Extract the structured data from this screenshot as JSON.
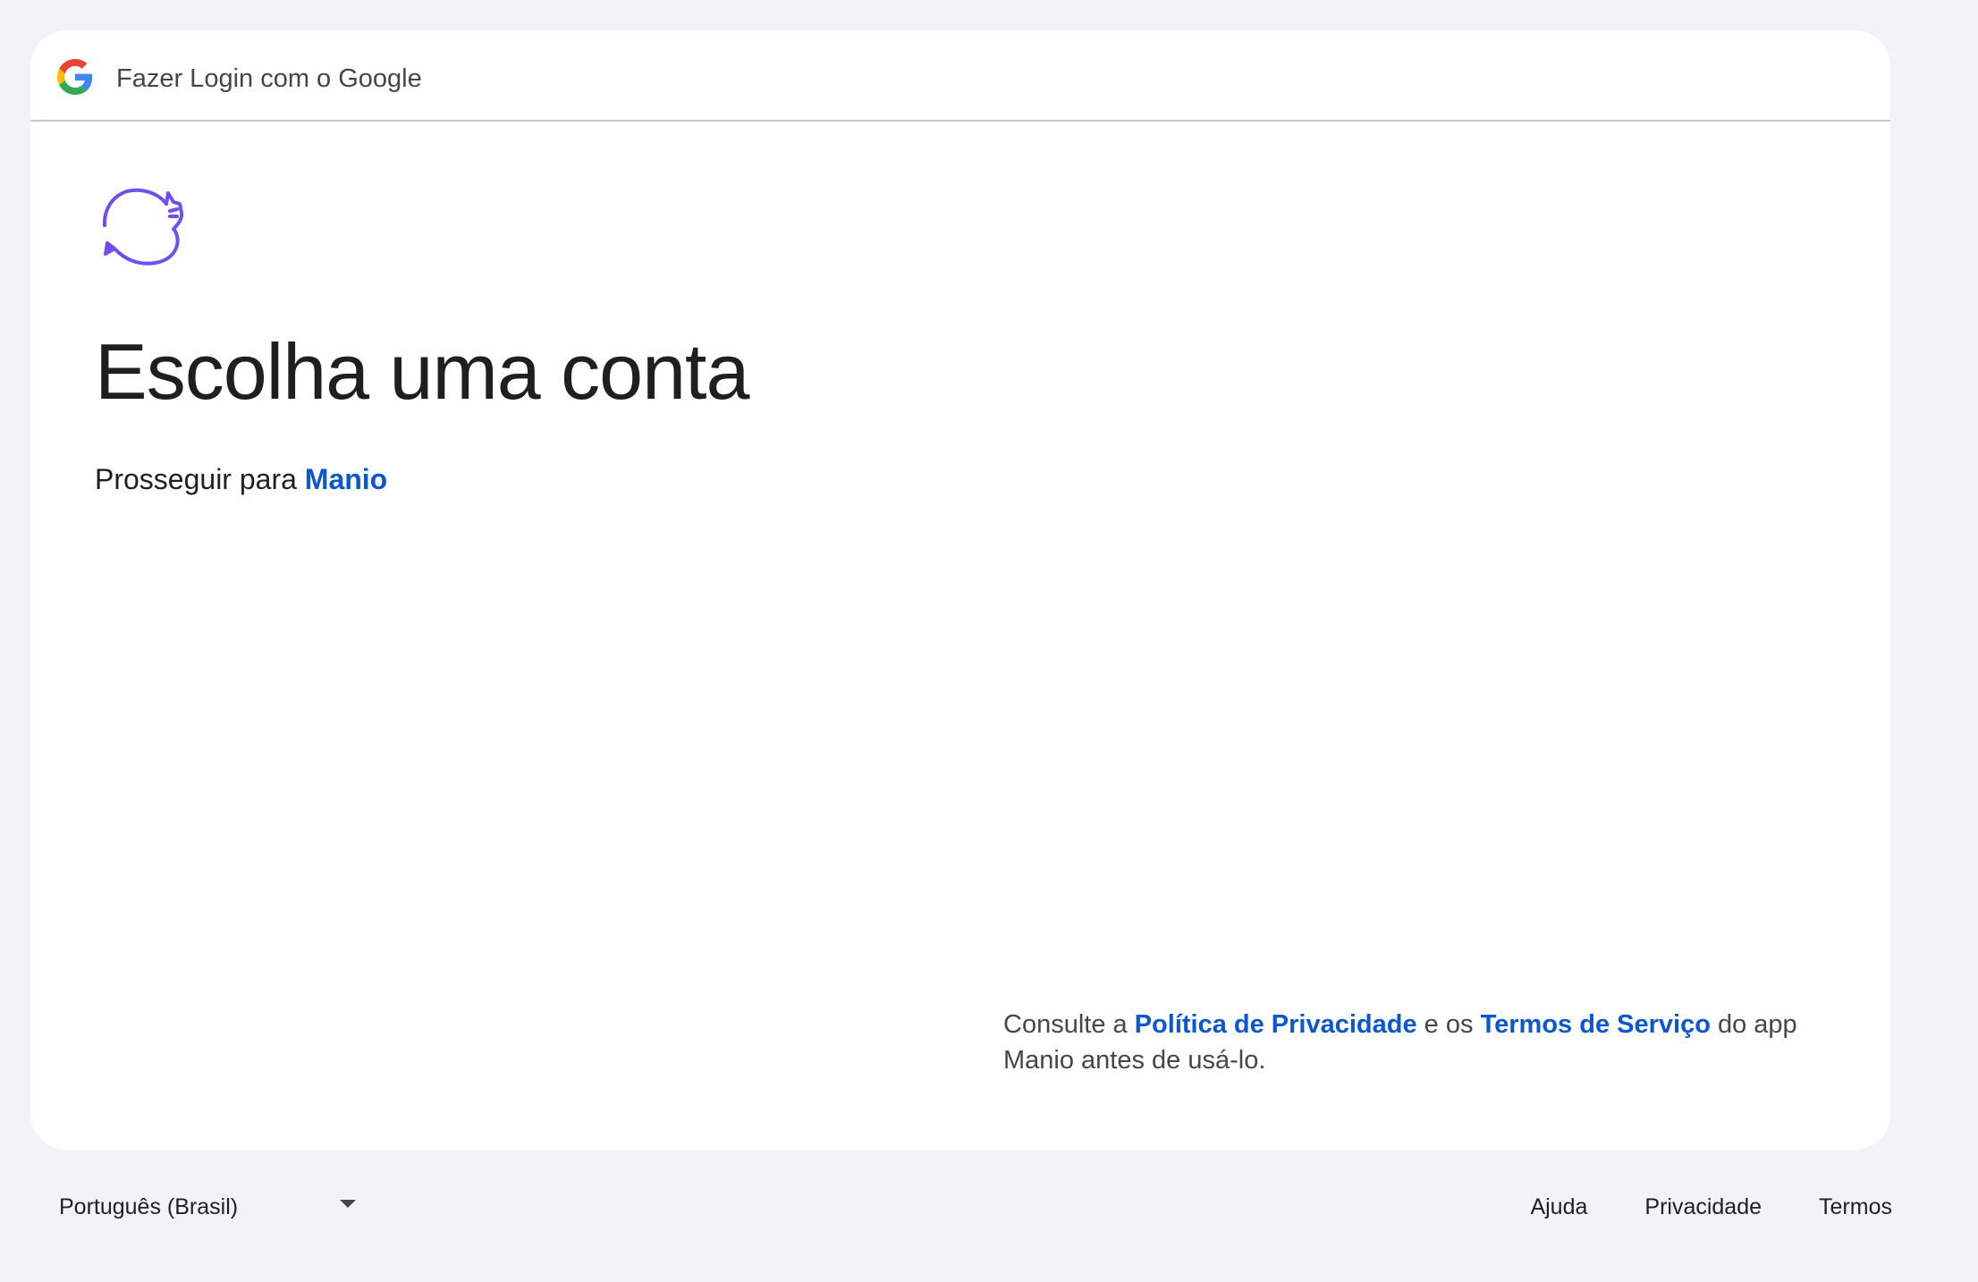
{
  "header": {
    "title": "Fazer Login com o Google",
    "logo_icon": "google-g-icon"
  },
  "app": {
    "logo_icon": "cat-cycle-logo-icon",
    "logo_color": "#6f4ef2",
    "name": "Manio"
  },
  "main": {
    "title": "Escolha uma conta",
    "subtitle_prefix": "Prosseguir para ",
    "subtitle_link": "Manio"
  },
  "legal": {
    "prefix": "Consulte a ",
    "privacy_link": "Política de Privacidade",
    "middle": " e os ",
    "terms_link": "Termos de Serviço",
    "suffix": " do app Manio antes de usá-lo."
  },
  "footer": {
    "language": "Português (Brasil)",
    "links": [
      "Ajuda",
      "Privacidade",
      "Termos"
    ]
  },
  "colors": {
    "page_background": "#f0f4f9",
    "card_background": "#ffffff",
    "link": "#0b57d0",
    "text": "#1f1f1f",
    "muted_text": "#444746"
  }
}
